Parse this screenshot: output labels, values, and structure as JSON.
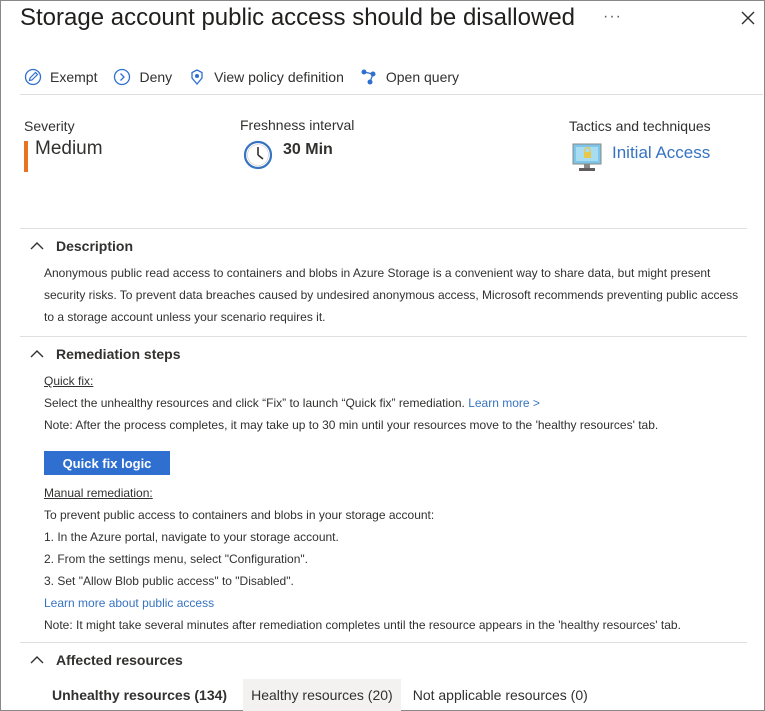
{
  "header": {
    "title": "Storage account public access should be disallowed",
    "more_label": "···",
    "close_label": "close"
  },
  "toolbar": {
    "exempt": "Exempt",
    "deny": "Deny",
    "view_policy": "View policy definition",
    "open_query": "Open query"
  },
  "summary": {
    "severity_label": "Severity",
    "severity_value": "Medium",
    "freshness_label": "Freshness interval",
    "freshness_value": "30 Min",
    "tactics_label": "Tactics and techniques",
    "tactics_value": "Initial Access"
  },
  "description": {
    "heading": "Description",
    "lines": [
      "Anonymous public read access to containers and blobs in Azure Storage is a convenient way to share data, but might present",
      "security risks. To prevent data breaches caused by undesired anonymous access, Microsoft recommends preventing public access",
      "to a storage account unless your scenario requires it."
    ]
  },
  "remediation": {
    "heading": "Remediation steps",
    "quick_fix_label": "Quick fix:",
    "quick_fix_text": "Select the unhealthy resources and click “Fix” to launch “Quick fix” remediation.",
    "learn_more": "Learn more >",
    "quick_fix_note": "Note: After the process completes, it may take up to 30 min until your resources move to the 'healthy resources' tab.",
    "quick_fix_button": "Quick fix logic",
    "manual_label": "Manual remediation:",
    "manual_intro": "To prevent public access to containers and blobs in your storage account:",
    "step1": "1. In the Azure portal, navigate to your storage account.",
    "step2": "2. From the settings menu, select \"Configuration\".",
    "step3": "3. Set \"Allow Blob public access\" to \"Disabled\".",
    "learn_more_public": "Learn more about public access",
    "manual_note": "Note: It might take several minutes after remediation completes until the resource appears in the 'healthy resources' tab."
  },
  "affected": {
    "heading": "Affected resources",
    "tabs": [
      "Unhealthy resources (134)",
      "Healthy resources (20)",
      "Not applicable resources (0)"
    ]
  },
  "colors": {
    "accent": "#2e6fd0",
    "link": "#3673c2",
    "severity_medium": "#e8741f"
  }
}
